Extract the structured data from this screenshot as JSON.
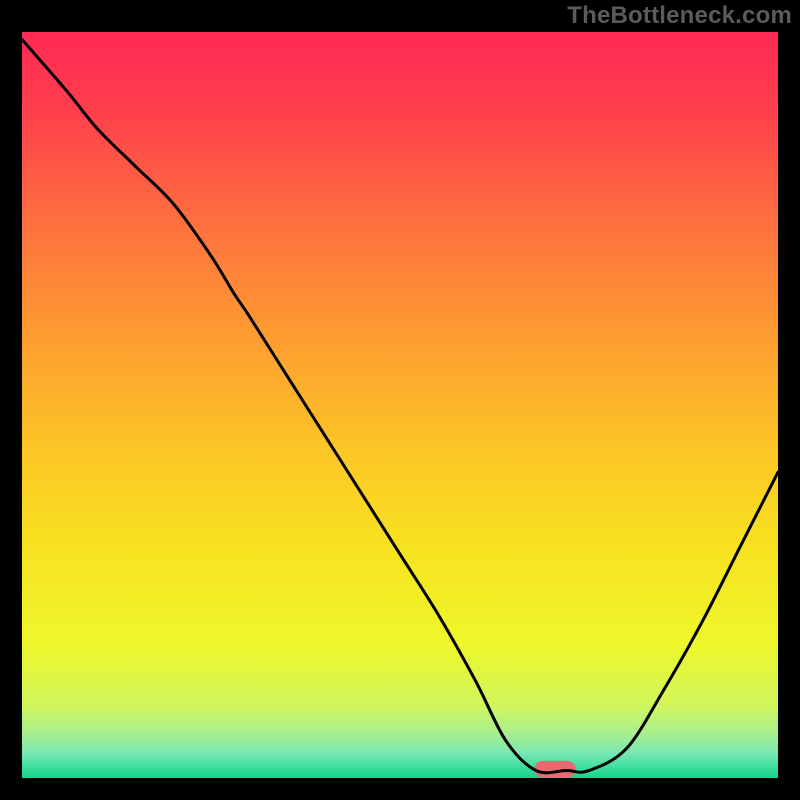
{
  "watermark": "TheBottleneck.com",
  "chart_data": {
    "type": "line",
    "title": "",
    "xlabel": "",
    "ylabel": "",
    "xlim": [
      0,
      100
    ],
    "ylim": [
      0,
      100
    ],
    "series": [
      {
        "name": "bottleneck-curve",
        "x": [
          0,
          6,
          10,
          15,
          20,
          25,
          28,
          30,
          35,
          40,
          45,
          50,
          55,
          60,
          64,
          68,
          72,
          75,
          80,
          85,
          90,
          95,
          100
        ],
        "y": [
          99,
          92,
          87,
          82,
          77,
          70,
          65,
          62,
          54,
          46,
          38,
          30,
          22,
          13,
          5,
          1,
          1,
          1,
          4,
          12,
          21,
          31,
          41
        ]
      }
    ],
    "marker": {
      "name": "highlight-pill",
      "x": 70.5,
      "y": 1.2,
      "width": 5.5,
      "height": 2.2,
      "color": "#e66a6f"
    },
    "background_gradient": {
      "stops": [
        {
          "offset": 0.0,
          "color": "#ff2a55"
        },
        {
          "offset": 0.1,
          "color": "#ff3d4c"
        },
        {
          "offset": 0.25,
          "color": "#fe6e3f"
        },
        {
          "offset": 0.4,
          "color": "#fd9a31"
        },
        {
          "offset": 0.55,
          "color": "#fcc326"
        },
        {
          "offset": 0.7,
          "color": "#f7e420"
        },
        {
          "offset": 0.82,
          "color": "#eef72a"
        },
        {
          "offset": 0.9,
          "color": "#d2f65a"
        },
        {
          "offset": 0.94,
          "color": "#a9ef8d"
        },
        {
          "offset": 0.965,
          "color": "#7de8b2"
        },
        {
          "offset": 0.985,
          "color": "#3fdf9f"
        },
        {
          "offset": 1.0,
          "color": "#14d487"
        }
      ]
    },
    "frame_color": "#000000",
    "frame_thickness_px": 22,
    "line_color": "#000000",
    "line_thickness_px": 3
  }
}
